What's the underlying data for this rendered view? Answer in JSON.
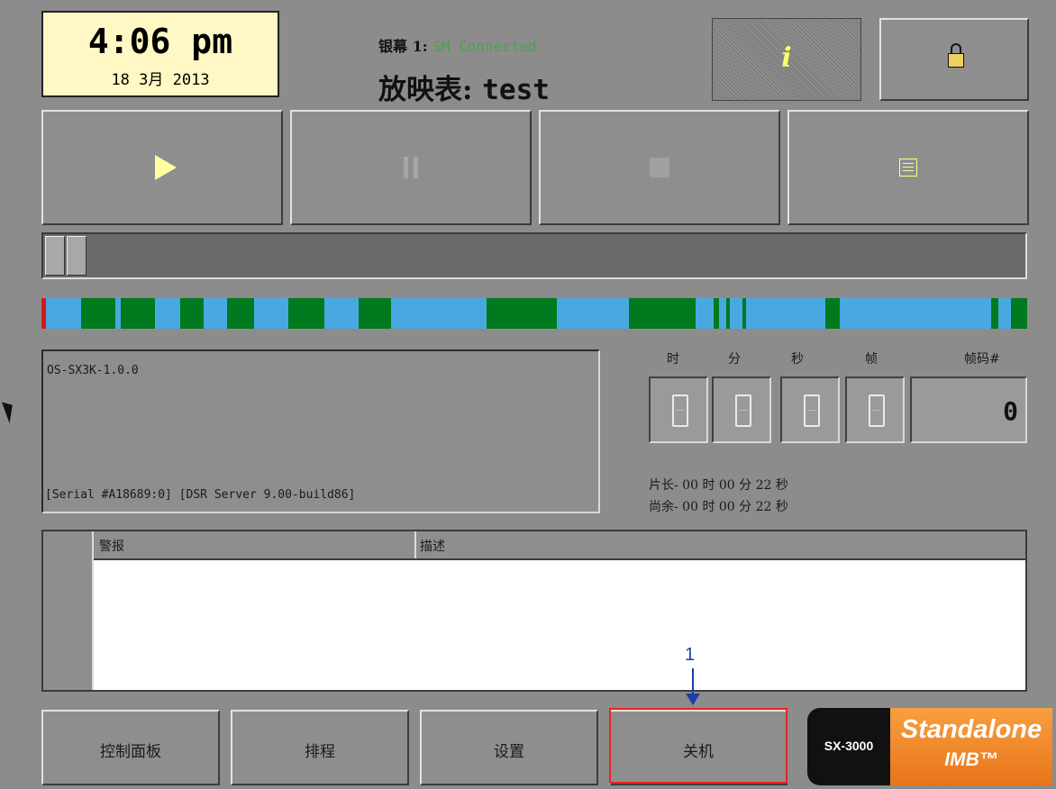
{
  "header": {
    "clock_time": "4:06 pm",
    "clock_date": "18  3月 2013",
    "screen_label": "银幕 1: ",
    "screen_status": "SM Connected",
    "playlist_label": "放映表: ",
    "playlist_name": "test"
  },
  "icons": {
    "info": "i",
    "lock": "lock-icon",
    "play": "play-icon",
    "pause": "pause-icon",
    "stop": "stop-icon",
    "list": "list-icon"
  },
  "timeline_colors": {
    "blue": "#4aa8e0",
    "green": "#007a1e",
    "red": "#d81818"
  },
  "log": {
    "version": "OS-SX3K-1.0.0",
    "server_info": "[Serial #A18689:0] [DSR Server 9.00-build86]"
  },
  "timecode": {
    "headers": [
      "时",
      "分",
      "秒",
      "帧",
      "帧码#"
    ],
    "frame_value": "0"
  },
  "duration": {
    "length": "片长- 00 时 00 分 22 秒",
    "remaining": "尚余- 00 时 00 分 22 秒"
  },
  "alarm": {
    "col_alarm": "警报",
    "col_desc": "描述"
  },
  "tabs": [
    "控制面板",
    "排程",
    "设置",
    "关机"
  ],
  "annotation": {
    "number": "1"
  },
  "brand": {
    "model": "SX-3000",
    "line1": "Standalone",
    "line2": "IMB™"
  }
}
